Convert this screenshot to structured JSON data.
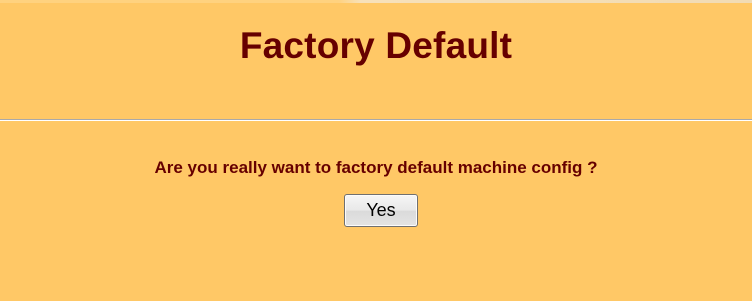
{
  "header": {
    "title": "Factory Default"
  },
  "confirm": {
    "message": "Are you really want to factory default machine config ?",
    "yes_label": "Yes"
  },
  "colors": {
    "background": "#FFC866",
    "title_text": "#660000",
    "message_text": "#660000"
  }
}
